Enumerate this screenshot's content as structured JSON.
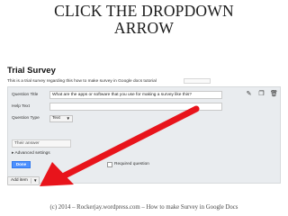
{
  "slide": {
    "title_line1": "CLICK THE DROPDOWN",
    "title_line2": "ARROW",
    "footer": "(c) 2014 – Rockerjay.wordpress.com – How to make Survey in Google Docs"
  },
  "form": {
    "title": "Trial Survey",
    "description": "This is a trial survey regarding this how to make survey in Google docs tutorial"
  },
  "editor": {
    "question_title_label": "Question Title",
    "question_title_value": "What are the apps or software that you use for making a survey like this?",
    "help_text_label": "Help Text",
    "question_type_label": "Question Type",
    "question_type_value": "Text",
    "answer_placeholder": "Their answer",
    "advanced_settings": "▸ Advanced settings",
    "done_label": "Done",
    "required_label": "Required question",
    "icons": [
      "pencil-icon",
      "copy-icon",
      "trash-icon"
    ]
  },
  "toolbar": {
    "add_item_label": "Add item",
    "caret": "▼"
  },
  "colors": {
    "done_button": "#4d90fe",
    "annotation_arrow": "#e8141b"
  }
}
